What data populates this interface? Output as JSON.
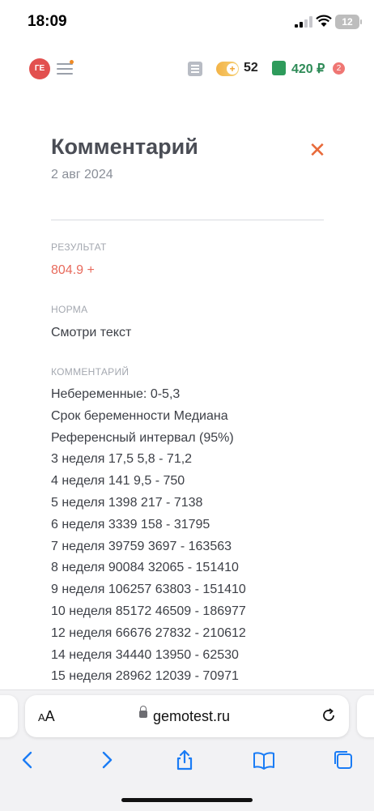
{
  "status_bar": {
    "time": "18:09",
    "battery": "12"
  },
  "header": {
    "avatar_initials": "ГЕ",
    "bonus_count": "52",
    "wallet_amount": "420 ₽",
    "cart_count": "2"
  },
  "comment_view": {
    "title": "Комментарий",
    "date": "2 авг 2024",
    "close_icon": "close-icon",
    "result_label": "РЕЗУЛЬТАТ",
    "result_value": "804.9 +",
    "norm_label": "НОРМА",
    "norm_value": "Смотри текст",
    "comment_label": "КОММЕНТАРИЙ",
    "comment_lines": [
      "Небеременные: 0-5,3",
      "Срок беременности Медиана",
      "Референсный интервал (95%)",
      "3 неделя 17,5 5,8 - 71,2",
      "4 неделя 141 9,5 - 750",
      "5 неделя 1398 217 - 7138",
      "6 неделя 3339 158 - 31795",
      "7 неделя 39759 3697 - 163563",
      "8 неделя 90084 32065 - 151410",
      "9 неделя 106257 63803 - 151410",
      "10 неделя 85172 46509 - 186977",
      "12 неделя 66676 27832 - 210612",
      "14 неделя 34440 13950 - 62530",
      "15 неделя 28962 12039 - 70971"
    ]
  },
  "browser": {
    "text_size_label": "AA",
    "url": "gemotest.ru"
  },
  "colors": {
    "avatar": "#e2504f",
    "result": "#e86a5c",
    "wallet": "#2e8b57",
    "close": "#e86a3a",
    "browser_accent": "#1a7cf5"
  }
}
